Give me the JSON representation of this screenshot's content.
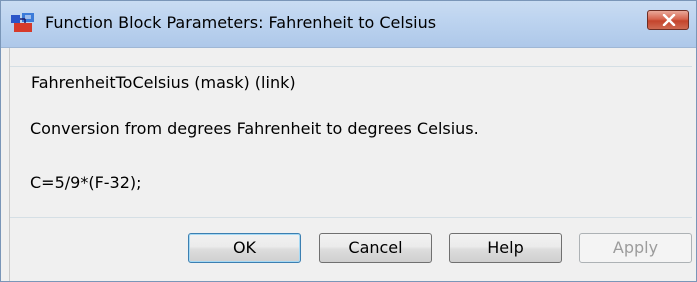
{
  "window": {
    "title": "Function Block Parameters: Fahrenheit to Celsius"
  },
  "group": {
    "title": "FahrenheitToCelsius (mask) (link)",
    "description": "Conversion from degrees Fahrenheit to degrees Celsius.",
    "formula": "C=5/9*(F-32);"
  },
  "buttons": {
    "ok": "OK",
    "cancel": "Cancel",
    "help": "Help",
    "apply": "Apply"
  },
  "icons": {
    "app": "simulink-block-icon",
    "close": "close-icon"
  },
  "colors": {
    "titlebar": "#bcd3ef",
    "close_button": "#c4442c",
    "dialog_bg": "#f0f0f0"
  }
}
